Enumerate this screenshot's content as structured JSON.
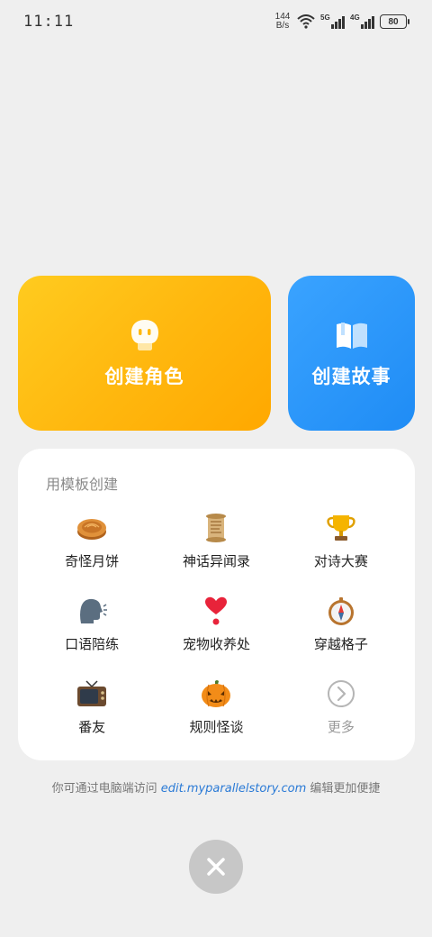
{
  "status_bar": {
    "time": "11:11",
    "net_speed_value": "144",
    "net_speed_unit": "B/s",
    "signal1_gen": "5G",
    "signal2_gen": "4G",
    "battery": "80"
  },
  "create_cards": {
    "role_label": "创建角色",
    "story_label": "创建故事",
    "role_icon": "ghost-face-icon",
    "story_icon": "open-book-icon"
  },
  "templates": {
    "title": "用模板创建",
    "items": [
      {
        "label": "奇怪月饼",
        "icon": "mooncake-icon"
      },
      {
        "label": "神话异闻录",
        "icon": "scroll-icon"
      },
      {
        "label": "对诗大赛",
        "icon": "trophy-icon"
      },
      {
        "label": "口语陪练",
        "icon": "speaking-head-icon"
      },
      {
        "label": "宠物收养处",
        "icon": "heart-icon"
      },
      {
        "label": "穿越格子",
        "icon": "compass-icon"
      },
      {
        "label": "番友",
        "icon": "television-icon"
      },
      {
        "label": "规则怪谈",
        "icon": "jack-o-lantern-icon"
      },
      {
        "label": "更多",
        "icon": "chevron-right-circle-icon"
      }
    ]
  },
  "footer": {
    "prefix": "你可通过电脑端访问 ",
    "link": "edit.myparallelstory.com",
    "suffix": " 编辑更加便捷"
  },
  "colors": {
    "role_card": "#ffb80f",
    "story_card": "#1f8cf5",
    "link": "#2a7ad6"
  }
}
